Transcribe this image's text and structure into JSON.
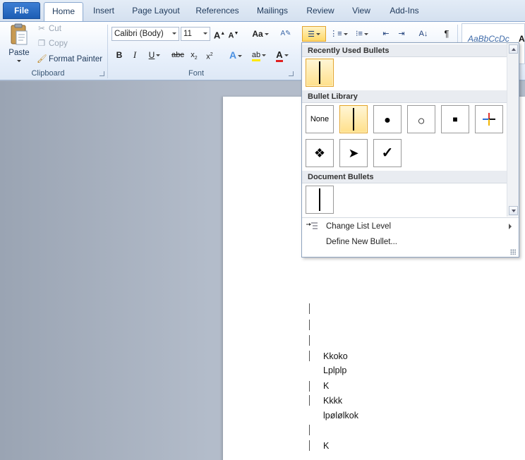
{
  "tabs": {
    "file": "File",
    "items": [
      "Home",
      "Insert",
      "Page Layout",
      "References",
      "Mailings",
      "Review",
      "View",
      "Add-Ins"
    ]
  },
  "clipboard": {
    "paste": "Paste",
    "cut": "Cut",
    "copy": "Copy",
    "format_painter": "Format Painter",
    "label": "Clipboard"
  },
  "font": {
    "family": "Calibri (Body)",
    "size": "11",
    "label": "Font"
  },
  "styles": {
    "preview": "AaBbCcDc",
    "preview2": "A"
  },
  "bullets_menu": {
    "recent_header": "Recently Used Bullets",
    "library_header": "Bullet Library",
    "document_header": "Document Bullets",
    "none_label": "None",
    "change_list_level": "Change List Level",
    "define_new_bullet": "Define New Bullet...",
    "library_glyphs": [
      "none",
      "bar",
      "●",
      "○",
      "■",
      "✚",
      "❖",
      "➤",
      "✓"
    ]
  },
  "document": {
    "lines": [
      "Kkoko",
      "Lplplp",
      "K",
      "Kkkk",
      "lpølølkok",
      "K"
    ]
  },
  "colors": {
    "accent": "#1d5db4",
    "selection": "#ffe08a"
  }
}
